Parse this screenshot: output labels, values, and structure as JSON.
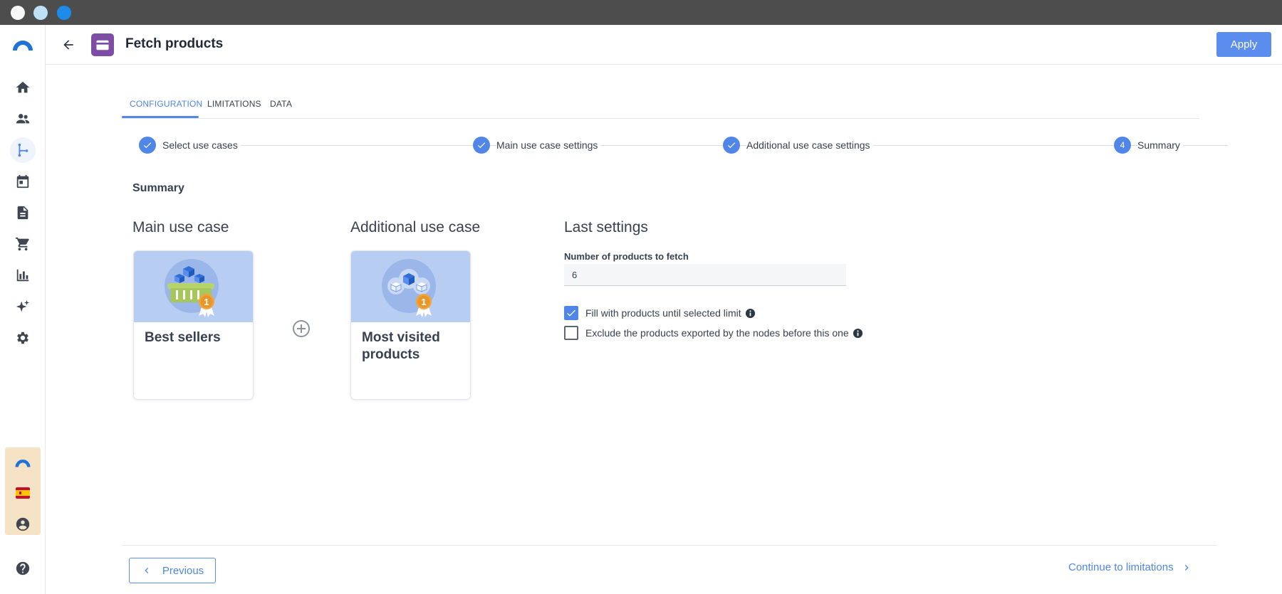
{
  "header": {
    "title": "Fetch products",
    "apply_label": "Apply"
  },
  "tabs": [
    {
      "label": "CONFIGURATION",
      "active": true
    },
    {
      "label": "LIMITATIONS",
      "active": false
    },
    {
      "label": "DATA",
      "active": false
    }
  ],
  "stepper": {
    "steps": [
      {
        "label": "Select use cases",
        "status": "done"
      },
      {
        "label": "Main use case settings",
        "status": "done"
      },
      {
        "label": "Additional use case settings",
        "status": "done"
      },
      {
        "label": "Summary",
        "status": "current",
        "number": "4"
      }
    ]
  },
  "summary": {
    "heading": "Summary",
    "main_use_case": {
      "heading": "Main use case",
      "card_title": "Best sellers"
    },
    "additional_use_case": {
      "heading": "Additional use case",
      "card_title": "Most visited products"
    },
    "last_settings": {
      "heading": "Last settings",
      "products_label": "Number of products to fetch",
      "products_value": "6",
      "fill_label": "Fill with products until selected limit",
      "fill_checked": true,
      "exclude_label": "Exclude the products exported by the nodes before this one",
      "exclude_checked": false
    }
  },
  "footer": {
    "previous_label": "Previous",
    "continue_label": "Continue to limitations"
  },
  "sidebar": {
    "items": [
      "home-icon",
      "people-icon",
      "flow-icon",
      "calendar-icon",
      "document-icon",
      "cart-icon",
      "chart-icon",
      "sparkle-icon",
      "gear-icon"
    ],
    "active": "flow-icon"
  },
  "colors": {
    "accent": "#4f86e8",
    "node_icon": "#7d4da5",
    "card_image_bg": "#b8cdf2",
    "brand_box": "#f6e3c6"
  }
}
